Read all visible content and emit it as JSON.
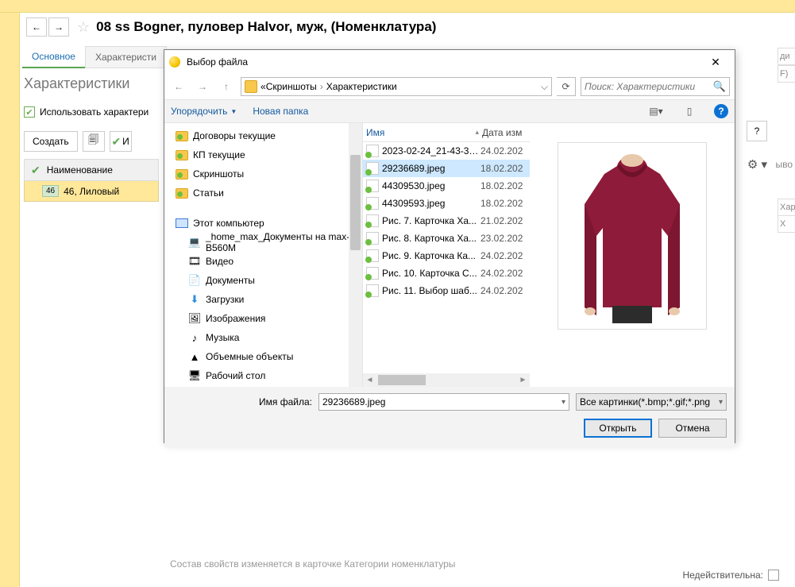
{
  "app": {
    "title": "08 ss Bogner, пуловер Halvor, муж, (Номенклатура)",
    "tabs": {
      "main": "Основное",
      "chars": "Характеристи"
    },
    "section": "Характеристики",
    "use_characteristics": "Использовать характери",
    "create": "Создать",
    "save_glyph": "💾",
    "green_check": "✔",
    "rest_i": "И",
    "list": {
      "header": "Наименование",
      "size": "46",
      "row1": "46, Лиловый"
    },
    "hint": "Состав свойств изменяется в карточке Категории номенклатуры",
    "ineffective": "Недействительна:",
    "help_q": "?",
    "gear": "⚙ ▾",
    "side": {
      "di": "ди",
      "f": "F)",
      "har": "Хар",
      "h": "Х"
    },
    "vyv": "ыво"
  },
  "dialog": {
    "title": "Выбор файла",
    "breadcrumb": {
      "pre": "«",
      "p1": "Скриншоты",
      "p2": "Характеристики"
    },
    "search_placeholder": "Поиск: Характеристики",
    "organize": "Упорядочить",
    "newfolder": "Новая папка",
    "cols": {
      "name": "Имя",
      "date": "Дата изм"
    },
    "tree": [
      {
        "label": "Договоры текущие",
        "icon": "folder"
      },
      {
        "label": "КП текущие",
        "icon": "folder"
      },
      {
        "label": "Скриншоты",
        "icon": "folder"
      },
      {
        "label": "Статьи",
        "icon": "folder"
      },
      {
        "label": "Этот компьютер",
        "icon": "pc",
        "top": true
      },
      {
        "label": "_home_max_Документы на max-B560M",
        "icon": "net",
        "indent": true
      },
      {
        "label": "Видео",
        "icon": "video",
        "indent": true
      },
      {
        "label": "Документы",
        "icon": "doc",
        "indent": true
      },
      {
        "label": "Загрузки",
        "icon": "down",
        "indent": true
      },
      {
        "label": "Изображения",
        "icon": "img",
        "indent": true
      },
      {
        "label": "Музыка",
        "icon": "music",
        "indent": true
      },
      {
        "label": "Объемные объекты",
        "icon": "3d",
        "indent": true
      },
      {
        "label": "Рабочий стол",
        "icon": "desk",
        "indent": true
      }
    ],
    "files": [
      {
        "name": "2023-02-24_21-43-31...",
        "date": "24.02.202"
      },
      {
        "name": "29236689.jpeg",
        "date": "18.02.202",
        "selected": true
      },
      {
        "name": "44309530.jpeg",
        "date": "18.02.202"
      },
      {
        "name": "44309593.jpeg",
        "date": "18.02.202"
      },
      {
        "name": "Рис. 7. Карточка Ха...",
        "date": "21.02.202"
      },
      {
        "name": "Рис. 8. Карточка Ха...",
        "date": "23.02.202"
      },
      {
        "name": "Рис. 9. Карточка Ка...",
        "date": "24.02.202"
      },
      {
        "name": "Рис. 10. Карточка С...",
        "date": "24.02.202"
      },
      {
        "name": "Рис. 11. Выбор шаб...",
        "date": "24.02.202"
      }
    ],
    "filename_label": "Имя файла:",
    "filename_value": "29236689.jpeg",
    "filter": "Все картинки(*.bmp;*.gif;*.png",
    "open": "Открыть",
    "cancel": "Отмена"
  }
}
